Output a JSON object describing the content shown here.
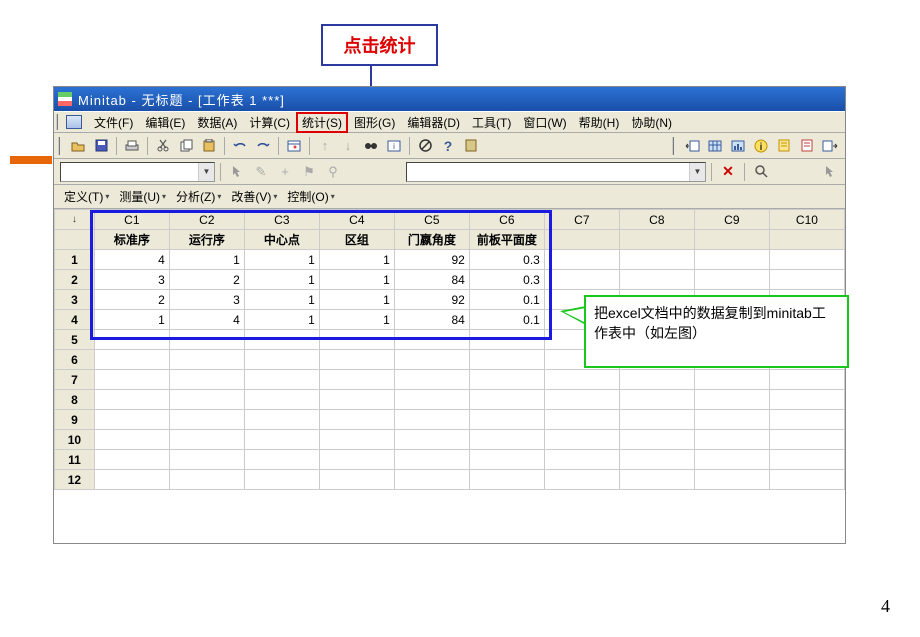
{
  "annotations": {
    "top_callout": "点击统计",
    "green_callout": "把excel文档中的数据复制到minitab工作表中（如左图）"
  },
  "titlebar": "Minitab - 无标题 - [工作表 1 ***]",
  "menus": {
    "file": "文件(F)",
    "edit": "编辑(E)",
    "data": "数据(A)",
    "calc": "计算(C)",
    "stat": "统计(S)",
    "graph": "图形(G)",
    "editor": "编辑器(D)",
    "tools": "工具(T)",
    "window": "窗口(W)",
    "help": "帮助(H)",
    "assist": "协助(N)"
  },
  "sixsigma": {
    "define": "定义(T)",
    "measure": "测量(U)",
    "analyze": "分析(Z)",
    "improve": "改善(V)",
    "control": "控制(O)"
  },
  "columns": [
    "C1",
    "C2",
    "C3",
    "C4",
    "C5",
    "C6",
    "C7",
    "C8",
    "C9",
    "C10"
  ],
  "col_names": [
    "标准序",
    "运行序",
    "中心点",
    "区组",
    "门嬴角度",
    "前板平面度",
    "",
    "",
    "",
    ""
  ],
  "chart_data": {
    "type": "table",
    "columns": [
      "标准序",
      "运行序",
      "中心点",
      "区组",
      "门嬴角度",
      "前板平面度"
    ],
    "rows": [
      {
        "标准序": 4,
        "运行序": 1,
        "中心点": 1,
        "区组": 1,
        "门嬴角度": 92,
        "前板平面度": 0.3
      },
      {
        "标准序": 3,
        "运行序": 2,
        "中心点": 1,
        "区组": 1,
        "门嬴角度": 84,
        "前板平面度": 0.3
      },
      {
        "标准序": 2,
        "运行序": 3,
        "中心点": 1,
        "区组": 1,
        "门嬴角度": 92,
        "前板平面度": 0.1
      },
      {
        "标准序": 1,
        "运行序": 4,
        "中心点": 1,
        "区组": 1,
        "门嬴角度": 84,
        "前板平面度": 0.1
      }
    ]
  },
  "row_headers": [
    "1",
    "2",
    "3",
    "4",
    "5",
    "6",
    "7",
    "8",
    "9",
    "10",
    "11",
    "12"
  ],
  "page_number": "4"
}
